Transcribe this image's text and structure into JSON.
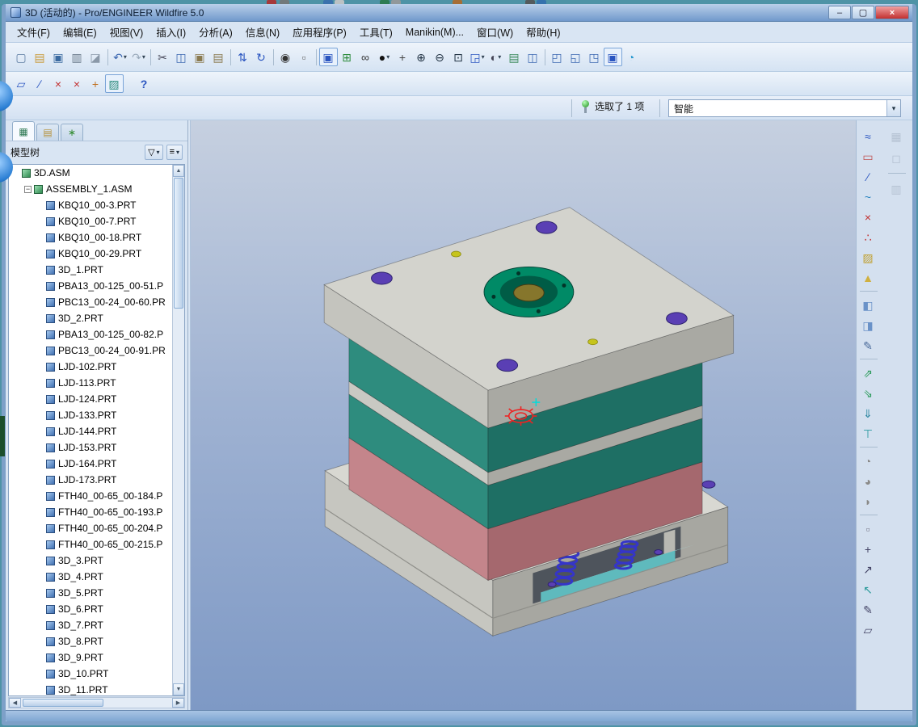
{
  "colors": {
    "desktop": "#4e93a6",
    "window-border": "#7da0c8",
    "titlebar-1": "#b9cfe9",
    "titlebar-2": "#7199cc",
    "chrome": "#d9e5f3",
    "chrome-dark": "#b8cde4",
    "tree-bg": "#ffffff",
    "viewport-1": "#c6d0e0",
    "viewport-2": "#9fb2d2",
    "viewport-3": "#7e99c5",
    "close-red": "#c23030",
    "accent": "#2a55c0",
    "top-plate-top": "#d3d3cd",
    "top-plate-left": "#c4c4be",
    "top-plate-right": "#a9a9a3",
    "teal-left": "#2e8c7e",
    "teal-right": "#1e6f64",
    "stripe-left": "#c9c9c3",
    "stripe-right": "#a9a9a3",
    "mauve-left": "#c4858b",
    "mauve-right": "#a5686e",
    "base-top": "#d8d8d2",
    "base-left": "#c6c6c0",
    "base-right": "#a7a7a1",
    "opening": "#4e545c",
    "cyan-top": "#aadfdf",
    "cyan-front": "#5fbabd",
    "pillar": "#b9b9b3",
    "spring": "#3535c8",
    "ring-green": "#008a66",
    "ring-dark": "#005c46",
    "ring-center": "#86762c",
    "hole-purple": "#5a3fb4",
    "dot-yellow": "#c6c41c",
    "selected-red": "#ee2222",
    "sel-cyan": "#00dcdc"
  },
  "window": {
    "title": "3D (活动的) - Pro/ENGINEER Wildfire 5.0",
    "min_glyph": "–",
    "max_glyph": "▢",
    "close_glyph": "×"
  },
  "menu_bar": {
    "items": [
      {
        "name": "menu-file",
        "label": "文件(F)"
      },
      {
        "name": "menu-edit",
        "label": "编辑(E)"
      },
      {
        "name": "menu-view",
        "label": "视图(V)"
      },
      {
        "name": "menu-insert",
        "label": "插入(I)"
      },
      {
        "name": "menu-analysis",
        "label": "分析(A)"
      },
      {
        "name": "menu-info",
        "label": "信息(N)"
      },
      {
        "name": "menu-applications",
        "label": "应用程序(P)"
      },
      {
        "name": "menu-tools",
        "label": "工具(T)"
      },
      {
        "name": "menu-manikin",
        "label": "Manikin(M)..."
      },
      {
        "name": "menu-window",
        "label": "窗口(W)"
      },
      {
        "name": "menu-help",
        "label": "帮助(H)"
      }
    ]
  },
  "toolbar_main": {
    "icons": [
      {
        "name": "new-file",
        "glyph": "▢",
        "color": "#5a7aa0"
      },
      {
        "name": "open-file",
        "glyph": "▤",
        "color": "#c99a3a"
      },
      {
        "name": "save",
        "glyph": "▣",
        "color": "#3a6aa0"
      },
      {
        "name": "print",
        "glyph": "▥",
        "color": "#6a7a8a"
      },
      {
        "name": "erase-display",
        "glyph": "◪",
        "color": "#8a98a8"
      },
      {
        "cls": "tbsep",
        "name": "separator",
        "inter": "false"
      },
      {
        "name": "undo",
        "glyph": "↶",
        "color": "#3a66b0",
        "caret": "▾"
      },
      {
        "name": "redo",
        "glyph": "↷",
        "color": "#9aaabb",
        "caret": "▾"
      },
      {
        "cls": "tbsep",
        "name": "separator",
        "inter": "false"
      },
      {
        "name": "cut",
        "glyph": "✂",
        "color": "#444455"
      },
      {
        "name": "copy",
        "glyph": "◫",
        "color": "#3a66b0"
      },
      {
        "name": "paste",
        "glyph": "▣",
        "color": "#8a7a50"
      },
      {
        "name": "paste-special",
        "glyph": "▤",
        "color": "#8a7a50"
      },
      {
        "cls": "tbsep",
        "name": "separator",
        "inter": "false"
      },
      {
        "name": "regenerate",
        "glyph": "⇅",
        "color": "#2a55c0"
      },
      {
        "name": "auto-regenerate",
        "glyph": "↻",
        "color": "#2a55c0"
      },
      {
        "cls": "tbsep",
        "name": "separator",
        "inter": "false"
      },
      {
        "name": "search",
        "glyph": "◉",
        "color": "#333333"
      },
      {
        "name": "select-box",
        "glyph": "▫",
        "color": "#666666"
      },
      {
        "cls": "tbsep",
        "name": "separator",
        "inter": "false"
      },
      {
        "name": "item-select",
        "glyph": "▣",
        "color": "#2a55c0",
        "cls": "tbtn hl"
      },
      {
        "name": "smart-pick",
        "glyph": "⊞",
        "color": "#2a8a3a"
      },
      {
        "name": "preview-glasses",
        "glyph": "∞",
        "color": "#333333"
      },
      {
        "name": "spin-center",
        "glyph": "●",
        "color": "#111111",
        "caret": "▾"
      },
      {
        "name": "pan-zoom",
        "glyph": "+",
        "color": "#444444"
      },
      {
        "name": "zoom-in",
        "glyph": "⊕",
        "color": "#223344"
      },
      {
        "name": "zoom-out",
        "glyph": "⊖",
        "color": "#223344"
      },
      {
        "name": "refit",
        "glyph": "⊡",
        "color": "#223344"
      },
      {
        "name": "named-views",
        "glyph": "◲",
        "color": "#2a55c0",
        "caret": "▾"
      },
      {
        "name": "display-style",
        "glyph": "◐",
        "color": "#444455",
        "caret": "▾"
      },
      {
        "name": "layers",
        "glyph": "▤",
        "color": "#3a8a5a"
      },
      {
        "name": "view-manager",
        "glyph": "◫",
        "color": "#3a66b0"
      },
      {
        "cls": "tbsep",
        "name": "separator",
        "inter": "false"
      },
      {
        "name": "window-new",
        "glyph": "◰",
        "color": "#3a66b0"
      },
      {
        "name": "window-tile",
        "glyph": "◱",
        "color": "#3a66b0"
      },
      {
        "name": "window-cascade",
        "glyph": "◳",
        "color": "#3a66b0"
      },
      {
        "name": "window-active",
        "glyph": "▣",
        "color": "#2a55c0",
        "cls": "tbtn hl"
      },
      {
        "name": "appearance-gallery",
        "glyph": "◔",
        "color": "#2a9ad0"
      }
    ]
  },
  "toolbar_secondary": {
    "icons": [
      {
        "name": "sketcher-tool",
        "glyph": "▱",
        "color": "#2a55c0"
      },
      {
        "name": "datum-plane-tool",
        "glyph": "∕",
        "color": "#2a55c0"
      },
      {
        "name": "datum-point-tool",
        "glyph": "×",
        "color": "#c23030"
      },
      {
        "name": "field-point-tool",
        "glyph": "×",
        "color": "#c23030"
      },
      {
        "name": "coordinate-system-tool",
        "glyph": "+",
        "color": "#c07020"
      },
      {
        "name": "sketch-active-tool",
        "glyph": "▨",
        "color": "#2e8c7e",
        "cls": "tbtn hl"
      },
      {
        "name": "context-help",
        "glyph": "?",
        "color": "#2a55c0",
        "cls": "tbtn help"
      }
    ]
  },
  "selection_bar": {
    "status_text": "选取了 1 项",
    "combo_value": "智能",
    "caret": "▾"
  },
  "model_tree": {
    "title": "模型树",
    "filter_glyph": "▽",
    "settings_glyph": "≡",
    "caret": "▾",
    "up_arrow": "▲",
    "down_arrow": "▼",
    "left_arrow": "◀",
    "right_arrow": "▶",
    "tabs": [
      {
        "name": "tab-model-tree",
        "glyph": "▦",
        "color": "#2f7a55",
        "cls": "tab active"
      },
      {
        "name": "tab-folder-browser",
        "glyph": "▤",
        "color": "#b5923c",
        "cls": "tab"
      },
      {
        "name": "tab-favorites",
        "glyph": "∗",
        "color": "#2f8a2f",
        "cls": "tab"
      }
    ],
    "items": [
      {
        "label": "3D.ASM",
        "level": 0,
        "iconCls": "ticon asm"
      },
      {
        "label": "ASSEMBLY_1.ASM",
        "level": 1,
        "iconCls": "ticon asm",
        "exp": "−"
      },
      {
        "label": "KBQ10_00-3.PRT",
        "level": 2,
        "iconCls": "ticon prt"
      },
      {
        "label": "KBQ10_00-7.PRT",
        "level": 2,
        "iconCls": "ticon prt"
      },
      {
        "label": "KBQ10_00-18.PRT",
        "level": 2,
        "iconCls": "ticon prt"
      },
      {
        "label": "KBQ10_00-29.PRT",
        "level": 2,
        "iconCls": "ticon prt"
      },
      {
        "label": "3D_1.PRT",
        "level": 2,
        "iconCls": "ticon prt"
      },
      {
        "label": "PBA13_00-125_00-51.P",
        "level": 2,
        "iconCls": "ticon prt"
      },
      {
        "label": "PBC13_00-24_00-60.PR",
        "level": 2,
        "iconCls": "ticon prt"
      },
      {
        "label": "3D_2.PRT",
        "level": 2,
        "iconCls": "ticon prt"
      },
      {
        "label": "PBA13_00-125_00-82.P",
        "level": 2,
        "iconCls": "ticon prt"
      },
      {
        "label": "PBC13_00-24_00-91.PR",
        "level": 2,
        "iconCls": "ticon prt"
      },
      {
        "label": "LJD-102.PRT",
        "level": 2,
        "iconCls": "ticon prt"
      },
      {
        "label": "LJD-113.PRT",
        "level": 2,
        "iconCls": "ticon prt"
      },
      {
        "label": "LJD-124.PRT",
        "level": 2,
        "iconCls": "ticon prt"
      },
      {
        "label": "LJD-133.PRT",
        "level": 2,
        "iconCls": "ticon prt"
      },
      {
        "label": "LJD-144.PRT",
        "level": 2,
        "iconCls": "ticon prt"
      },
      {
        "label": "LJD-153.PRT",
        "level": 2,
        "iconCls": "ticon prt"
      },
      {
        "label": "LJD-164.PRT",
        "level": 2,
        "iconCls": "ticon prt"
      },
      {
        "label": "LJD-173.PRT",
        "level": 2,
        "iconCls": "ticon prt"
      },
      {
        "label": "FTH40_00-65_00-184.P",
        "level": 2,
        "iconCls": "ticon prt"
      },
      {
        "label": "FTH40_00-65_00-193.P",
        "level": 2,
        "iconCls": "ticon prt"
      },
      {
        "label": "FTH40_00-65_00-204.P",
        "level": 2,
        "iconCls": "ticon prt"
      },
      {
        "label": "FTH40_00-65_00-215.P",
        "level": 2,
        "iconCls": "ticon prt"
      },
      {
        "label": "3D_3.PRT",
        "level": 2,
        "iconCls": "ticon prt"
      },
      {
        "label": "3D_4.PRT",
        "level": 2,
        "iconCls": "ticon prt"
      },
      {
        "label": "3D_5.PRT",
        "level": 2,
        "iconCls": "ticon prt"
      },
      {
        "label": "3D_6.PRT",
        "level": 2,
        "iconCls": "ticon prt"
      },
      {
        "label": "3D_7.PRT",
        "level": 2,
        "iconCls": "ticon prt"
      },
      {
        "label": "3D_8.PRT",
        "level": 2,
        "iconCls": "ticon prt"
      },
      {
        "label": "3D_9.PRT",
        "level": 2,
        "iconCls": "ticon prt"
      },
      {
        "label": "3D_10.PRT",
        "level": 2,
        "iconCls": "ticon prt"
      },
      {
        "label": "3D_11.PRT",
        "level": 2,
        "iconCls": "ticon prt"
      }
    ]
  },
  "right_toolbar": {
    "icons": [
      {
        "name": "analysis-graph",
        "glyph": "≈",
        "color": "#2a55c0"
      },
      {
        "name": "sketch-rectangle",
        "glyph": "▭",
        "color": "#c05050"
      },
      {
        "name": "datum-line",
        "glyph": "∕",
        "color": "#2a55c0"
      },
      {
        "name": "spline-tool",
        "glyph": "~",
        "color": "#2a85c0"
      },
      {
        "name": "delete-segment",
        "glyph": "×",
        "color": "#c23030"
      },
      {
        "name": "point-pattern",
        "glyph": "∴",
        "color": "#c23030"
      },
      {
        "name": "hatch-tool",
        "glyph": "▨",
        "color": "#c0a030"
      },
      {
        "name": "warn-triangle",
        "glyph": "▲",
        "color": "#d0b040"
      },
      {
        "cls": "rsep",
        "name": "separator",
        "inter": "false"
      },
      {
        "name": "appearance-layer-1",
        "glyph": "◧",
        "color": "#6a92c8"
      },
      {
        "name": "appearance-layer-2",
        "glyph": "◨",
        "color": "#6a92c8"
      },
      {
        "name": "appearance-edit",
        "glyph": "✎",
        "color": "#4a6a9a"
      },
      {
        "cls": "rsep",
        "name": "separator",
        "inter": "false"
      },
      {
        "name": "view-export-up",
        "glyph": "⇗",
        "color": "#2a9a5a"
      },
      {
        "name": "view-export-down",
        "glyph": "⇘",
        "color": "#2a9a5a"
      },
      {
        "name": "copy-geometry",
        "glyph": "⇓",
        "color": "#2a85a0"
      },
      {
        "name": "tee-tool",
        "glyph": "⊤",
        "color": "#2a9aa0"
      },
      {
        "cls": "rsep",
        "name": "separator",
        "inter": "false"
      },
      {
        "name": "round-tool",
        "glyph": "◔",
        "color": "#8a8a88"
      },
      {
        "name": "chamfer-tool",
        "glyph": "◕",
        "color": "#8a8a88"
      },
      {
        "name": "shell-tool",
        "glyph": "◗",
        "color": "#8a8a88"
      },
      {
        "cls": "rsep",
        "name": "separator",
        "inter": "false"
      },
      {
        "name": "small-plane",
        "glyph": "▫",
        "color": "#777788"
      },
      {
        "name": "axis-point",
        "glyph": "+",
        "color": "#444466"
      },
      {
        "name": "measure-arrow",
        "glyph": "↗",
        "color": "#444466"
      },
      {
        "name": "select-arrow",
        "glyph": "↖",
        "color": "#2a9a9a"
      },
      {
        "name": "sketch-pencil",
        "glyph": "✎",
        "color": "#444466"
      },
      {
        "name": "polygon-tool",
        "glyph": "▱",
        "color": "#444466"
      }
    ],
    "faint_icons": [
      {
        "name": "table-grid",
        "glyph": "▦",
        "color": "#9aa8ba",
        "cls": "tbtn faint"
      },
      {
        "name": "cube-display",
        "glyph": "◻",
        "color": "#9aa8ba",
        "cls": "tbtn faint"
      },
      {
        "cls": "rsep",
        "name": "separator",
        "inter": "false"
      },
      {
        "name": "chart-small",
        "glyph": "▥",
        "color": "#9aa8ba",
        "cls": "tbtn faint"
      }
    ]
  }
}
